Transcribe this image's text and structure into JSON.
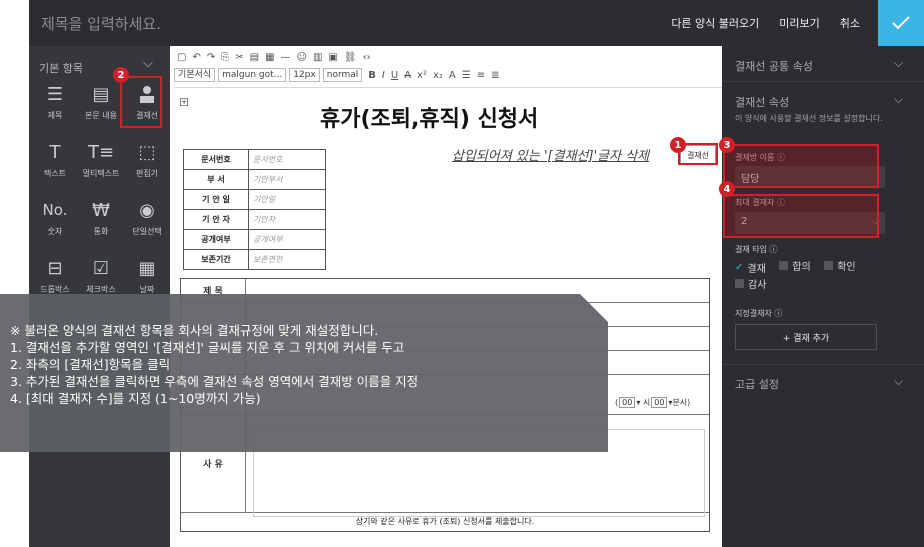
{
  "topbar": {
    "title_placeholder": "제목을 입력하세요.",
    "load_other": "다른 양식 불러오기",
    "preview": "미리보기",
    "cancel": "취소"
  },
  "left_panel": {
    "heading": "기본 항목",
    "items": [
      {
        "label": "제목",
        "icon": "title-icon"
      },
      {
        "label": "본문 내용",
        "icon": "body-text-icon"
      },
      {
        "label": "결재선",
        "icon": "approval-line-icon"
      },
      {
        "label": "텍스트",
        "icon": "text-icon"
      },
      {
        "label": "멀티텍스트",
        "icon": "multi-text-icon"
      },
      {
        "label": "편집기",
        "icon": "editor-icon"
      },
      {
        "label": "숫자",
        "icon": "number-icon"
      },
      {
        "label": "통화",
        "icon": "currency-icon"
      },
      {
        "label": "단일선택",
        "icon": "single-select-icon"
      },
      {
        "label": "드롭박스",
        "icon": "dropdown-icon"
      },
      {
        "label": "체크박스",
        "icon": "checkbox-icon"
      },
      {
        "label": "날짜",
        "icon": "date-icon"
      }
    ]
  },
  "toolbar": {
    "style_select": "기본서식",
    "font_select": "malgun got...",
    "size_select": "12px",
    "weight_select": "normal"
  },
  "document": {
    "title": "휴가(조퇴,휴직) 신청서",
    "tip_line": "삽입되어져 있는 '[결재선]'글자 삭제",
    "approval_cell": "결재선",
    "meta_rows": [
      {
        "key": "문서번호",
        "value": "문서번호"
      },
      {
        "key": "부    서",
        "value": "기안부서"
      },
      {
        "key": "기 안 일",
        "value": "기안일"
      },
      {
        "key": "기 안 자",
        "value": "기안자"
      },
      {
        "key": "공개여부",
        "value": "공개여부"
      },
      {
        "key": "보존기간",
        "value": "보존연한"
      }
    ],
    "form_title_key": "제    목",
    "reason_key": "사    유",
    "period_hour_1": "00",
    "period_hour_2": "00",
    "period_suffix": "분시)",
    "footer": "상기와 같은 사유로 휴가 (조퇴) 신청서를 제출합니다."
  },
  "right_panel": {
    "common_props": "결재선 공통 속성",
    "props": "결재선 속성",
    "props_desc": "이 양식에 사용할 결재선 정보를 설정합니다.",
    "name_label": "결재방 이름",
    "name_value": "담당",
    "max_label": "최대 결재자",
    "max_value": "2",
    "type_label": "결재 타입",
    "types": [
      "결재",
      "합의",
      "확인",
      "감사"
    ],
    "designated_label": "지정결재자",
    "add_button": "+ 결재 추가",
    "advanced": "고급 설정"
  },
  "overlay": {
    "heading": "※ 불러온 양식의 결재선 항목을 회사의 결재규정에 맞게 재설정합니다.",
    "step1": "1.  결재선을 추가할 영역인 '[결재선]' 글씨를 지운 후 그 위치에 커서를 두고",
    "step2": "2.  좌측의 [결재선]항목을 클릭",
    "step3": "3.  추가된 결재선을 클릭하면 우측에 결재선 속성 영역에서 결재방 이름을 지정",
    "step4": "4.  [최대 결재자 수]를 지정 (1~10명까지 가능)"
  },
  "badges": [
    "1",
    "2",
    "3",
    "4"
  ],
  "colors": {
    "accent": "#3bb4e6",
    "highlight": "#d0202a",
    "dark_bg": "#2b2d31",
    "panel_bg": "#35373b"
  }
}
